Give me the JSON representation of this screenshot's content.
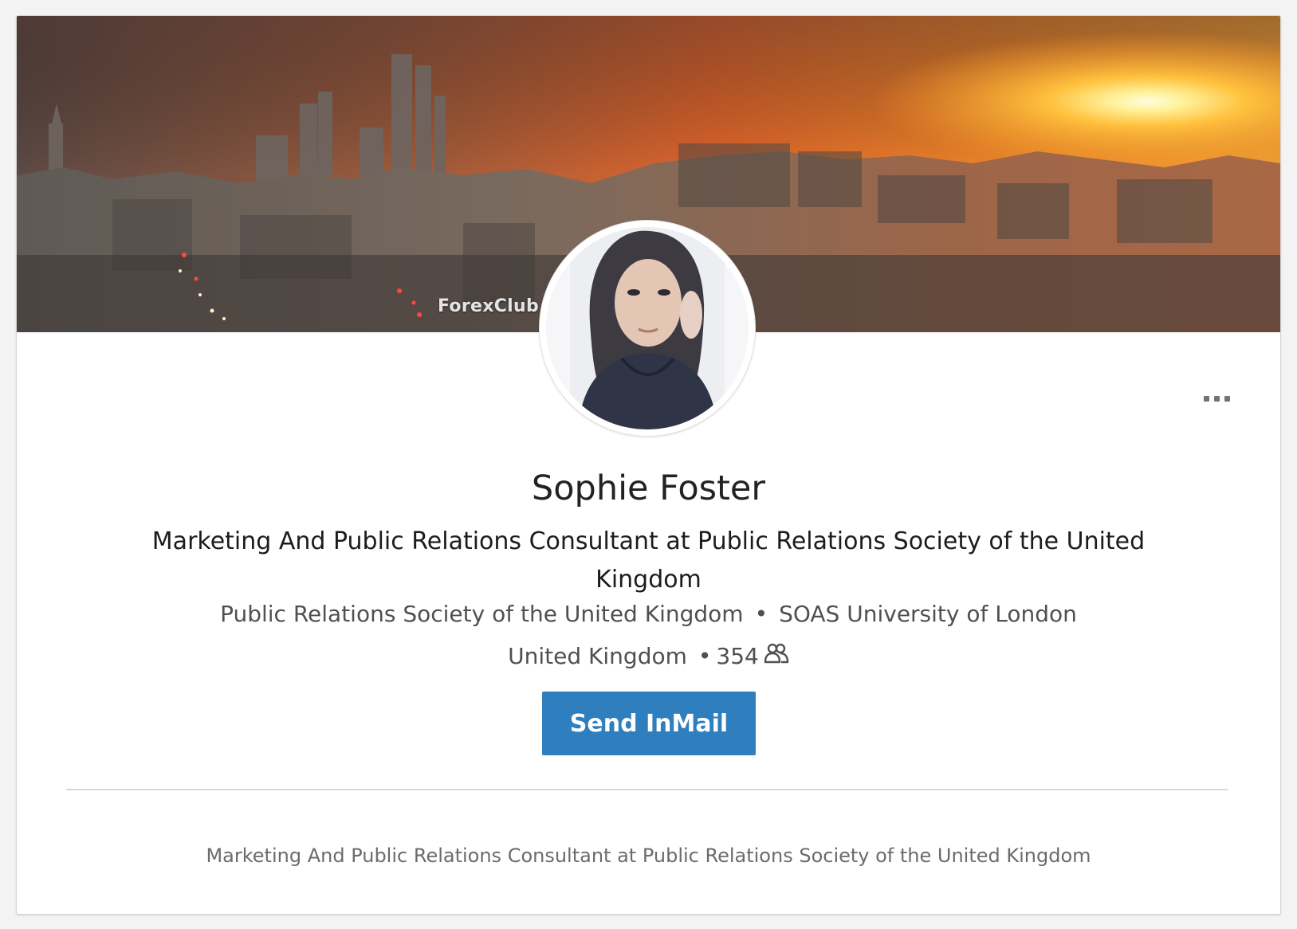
{
  "profile": {
    "name": "Sophie Foster",
    "headline": "Marketing And Public Relations Consultant at Public Relations Society of the United Kingdom",
    "current_company": "Public Relations Society of the United Kingdom",
    "education": "SOAS University of London",
    "separator": "•",
    "location": "United Kingdom",
    "location_separator": "•",
    "connections": "354",
    "summary": "Marketing And Public Relations Consultant at Public Relations Society of the United Kingdom"
  },
  "banner": {
    "watermark": "ForexClub"
  },
  "actions": {
    "inmail_label": "Send InMail"
  },
  "icons": {
    "more": "more-options-icon",
    "connections": "connections-icon"
  },
  "colors": {
    "accent": "#2f7fbe",
    "page_background": "#f3f3f3",
    "card_background": "#ffffff"
  }
}
